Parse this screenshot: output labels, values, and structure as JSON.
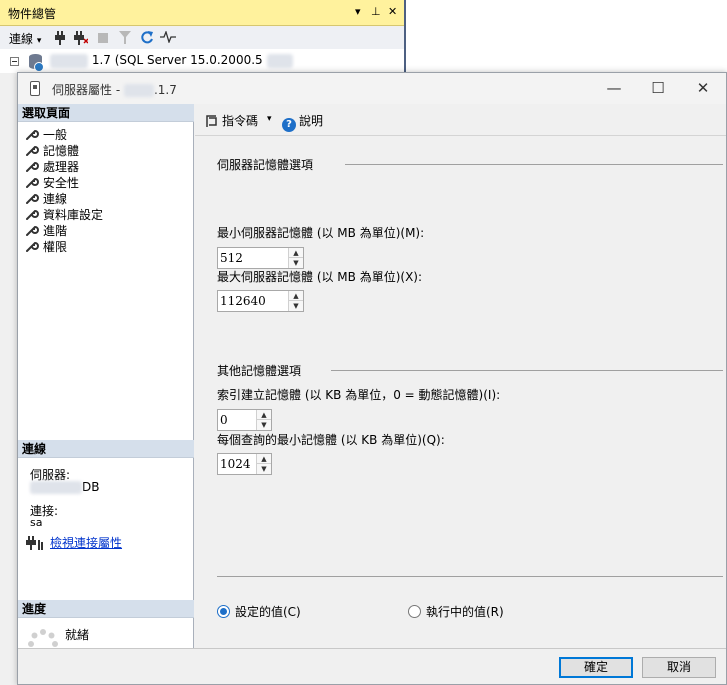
{
  "object_explorer": {
    "title": "物件總管",
    "title_controls": [
      "▾",
      "⊥",
      "✕"
    ],
    "toolbar": {
      "connect_label": "連線",
      "connect_dropdown": "▾"
    },
    "server_node_label": "1.7 (SQL Server 15.0.2000.5"
  },
  "dialog": {
    "title_prefix": "伺服器屬性 -",
    "title_suffix": ".1.7",
    "window_controls": {
      "minimize": "—",
      "maximize": "☐",
      "close": "✕"
    },
    "left_pane": {
      "select_page_header": "選取頁面",
      "pages": [
        {
          "label": "一般"
        },
        {
          "label": "記憶體"
        },
        {
          "label": "處理器"
        },
        {
          "label": "安全性"
        },
        {
          "label": "連線"
        },
        {
          "label": "資料庫設定"
        },
        {
          "label": "進階"
        },
        {
          "label": "權限"
        }
      ],
      "connection_header": "連線",
      "server_label": "伺服器:",
      "server_value_suffix": "DB",
      "connection_label": "連接:",
      "connection_value": "sa",
      "view_connection_link": "檢視連接屬性",
      "progress_header": "進度",
      "progress_status": "就緒"
    },
    "toolbar": {
      "script_label": "指令碼",
      "script_dropdown": "▾",
      "help_label": "說明"
    },
    "memory_options_title": "伺服器記憶體選項",
    "min_memory_label": "最小伺服器記憶體 (以 MB 為單位)(M):",
    "min_memory_value": "512",
    "max_memory_label": "最大伺服器記憶體 (以 MB 為單位)(X):",
    "max_memory_value": "112640",
    "other_options_title": "其他記憶體選項",
    "index_memory_label": "索引建立記憶體 (以 KB 為單位，0 = 動態記憶體)(I):",
    "index_memory_value": "0",
    "min_query_memory_label": "每個查詢的最小記憶體 (以 KB 為單位)(Q):",
    "min_query_memory_value": "1024",
    "radio_configured_label": "設定的值(C)",
    "radio_running_label": "執行中的值(R)",
    "ok_button_label": "確定",
    "cancel_button_label": "取消"
  }
}
